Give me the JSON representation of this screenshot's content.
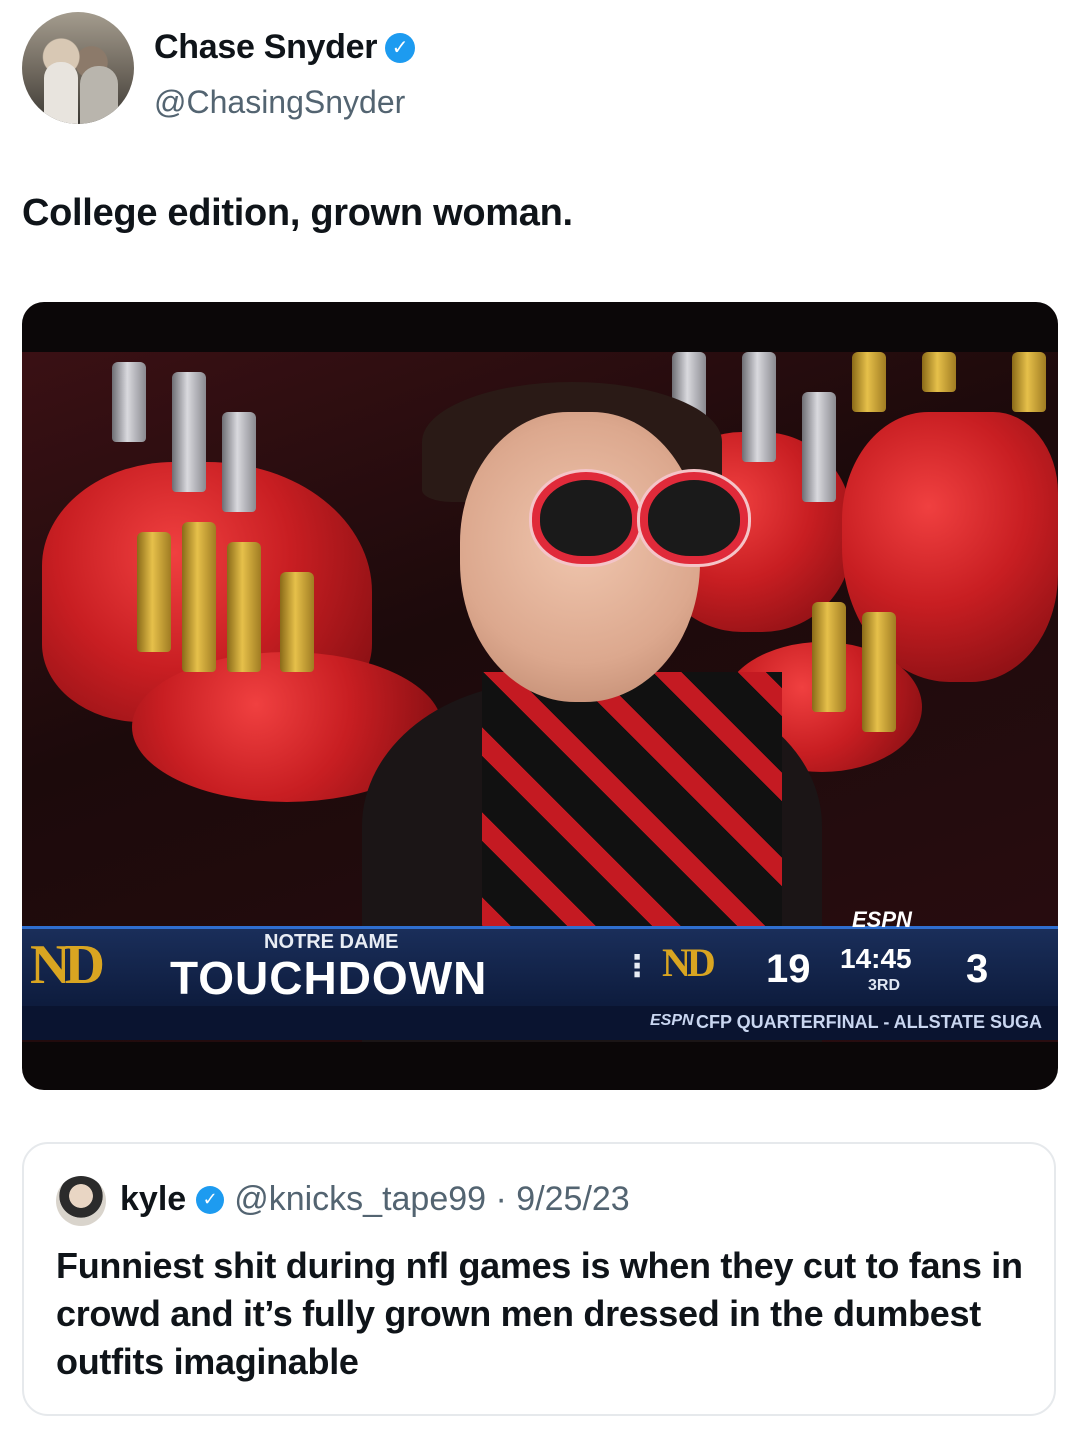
{
  "author": {
    "display_name": "Chase Snyder",
    "handle": "@ChasingSnyder",
    "verified_icon": "verified-badge-icon"
  },
  "tweet": {
    "text": "College edition, grown woman."
  },
  "broadcast": {
    "team_label": "NOTRE DAME",
    "event_label": "TOUCHDOWN",
    "network": "ESPN",
    "home_score": "19",
    "game_clock": "14:45",
    "quarter": "3RD",
    "away_score": "3",
    "ticker_network": "ESPN",
    "ticker_text": "CFP QUARTERFINAL - ALLSTATE SUGA"
  },
  "quoted_tweet": {
    "display_name": "kyle",
    "handle_date": "@knicks_tape99 · 9/25/23",
    "text": "Funniest shit during nfl games is when they cut to fans in crowd and it’s fully grown men dressed in the dumbest outfits imaginable"
  },
  "colors": {
    "verified": "#1d9bf0",
    "handle_gray": "#536471",
    "notre_dame_gold": "#d9a521",
    "scorebar_blue": "#0d1b3c"
  }
}
